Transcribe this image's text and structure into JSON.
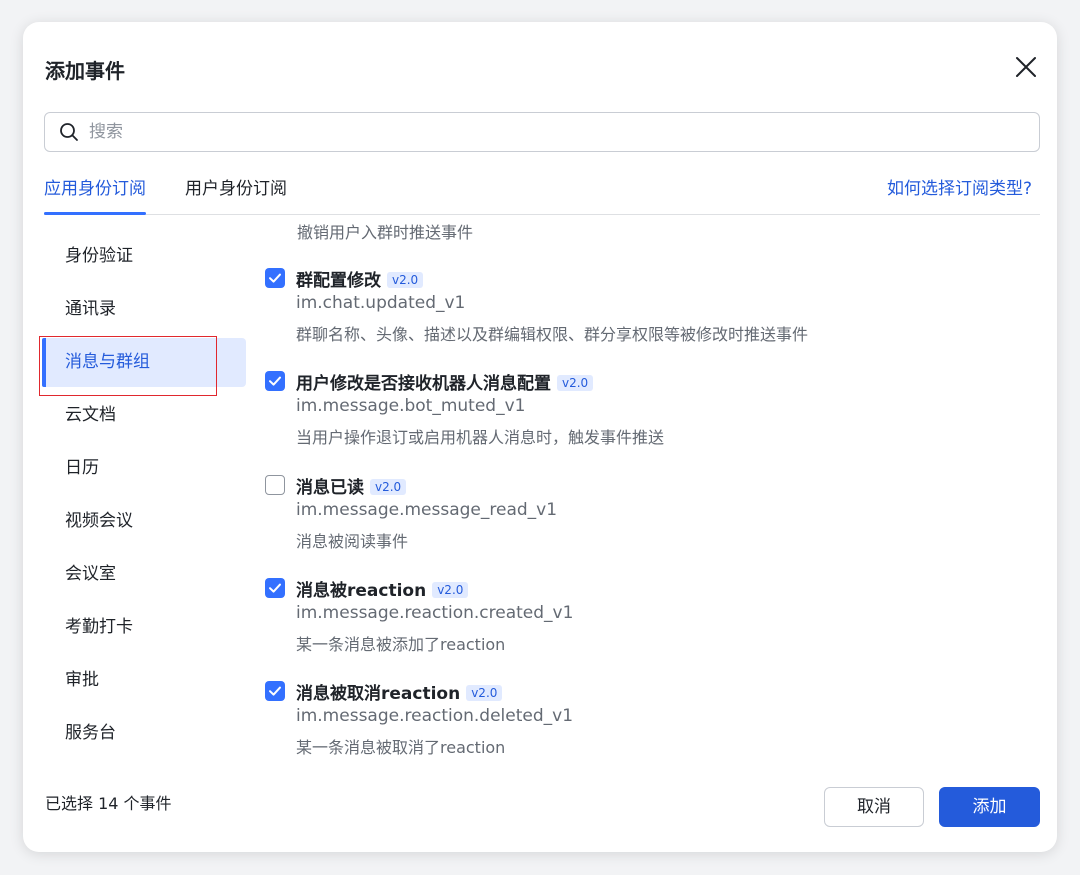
{
  "dialog": {
    "title": "添加事件",
    "close_icon": "close-icon"
  },
  "search": {
    "placeholder": "搜索",
    "value": "",
    "icon": "search-icon"
  },
  "tabs": [
    {
      "label": "应用身份订阅",
      "active": true
    },
    {
      "label": "用户身份订阅",
      "active": false
    }
  ],
  "help_link": "如何选择订阅类型?",
  "sidebar": {
    "items": [
      {
        "label": "身份验证"
      },
      {
        "label": "通讯录"
      },
      {
        "label": "消息与群组"
      },
      {
        "label": "云文档"
      },
      {
        "label": "日历"
      },
      {
        "label": "视频会议"
      },
      {
        "label": "会议室"
      },
      {
        "label": "考勤打卡"
      },
      {
        "label": "审批"
      },
      {
        "label": "服务台"
      }
    ],
    "active_index": 2
  },
  "events": {
    "cut_text": "撤销用户入群时推送事件",
    "items": [
      {
        "checked": true,
        "name": "群配置修改",
        "version": "v2.0",
        "key": "im.chat.updated_v1",
        "desc": "群聊名称、头像、描述以及群编辑权限、群分享权限等被修改时推送事件"
      },
      {
        "checked": true,
        "name": "用户修改是否接收机器人消息配置",
        "version": "v2.0",
        "key": "im.message.bot_muted_v1",
        "desc": "当用户操作退订或启用机器人消息时，触发事件推送"
      },
      {
        "checked": false,
        "name": "消息已读",
        "version": "v2.0",
        "key": "im.message.message_read_v1",
        "desc": "消息被阅读事件"
      },
      {
        "checked": true,
        "name": "消息被reaction",
        "version": "v2.0",
        "key": "im.message.reaction.created_v1",
        "desc": "某一条消息被添加了reaction"
      },
      {
        "checked": true,
        "name": "消息被取消reaction",
        "version": "v2.0",
        "key": "im.message.reaction.deleted_v1",
        "desc": "某一条消息被取消了reaction"
      }
    ]
  },
  "footer": {
    "selected_text": "已选择 14 个事件",
    "cancel_label": "取消",
    "add_label": "添加"
  },
  "colors": {
    "accent": "#3370ff",
    "primary_button": "#245bdb",
    "active_bg": "#e1eaff",
    "annotation_red": "#e0282e"
  }
}
